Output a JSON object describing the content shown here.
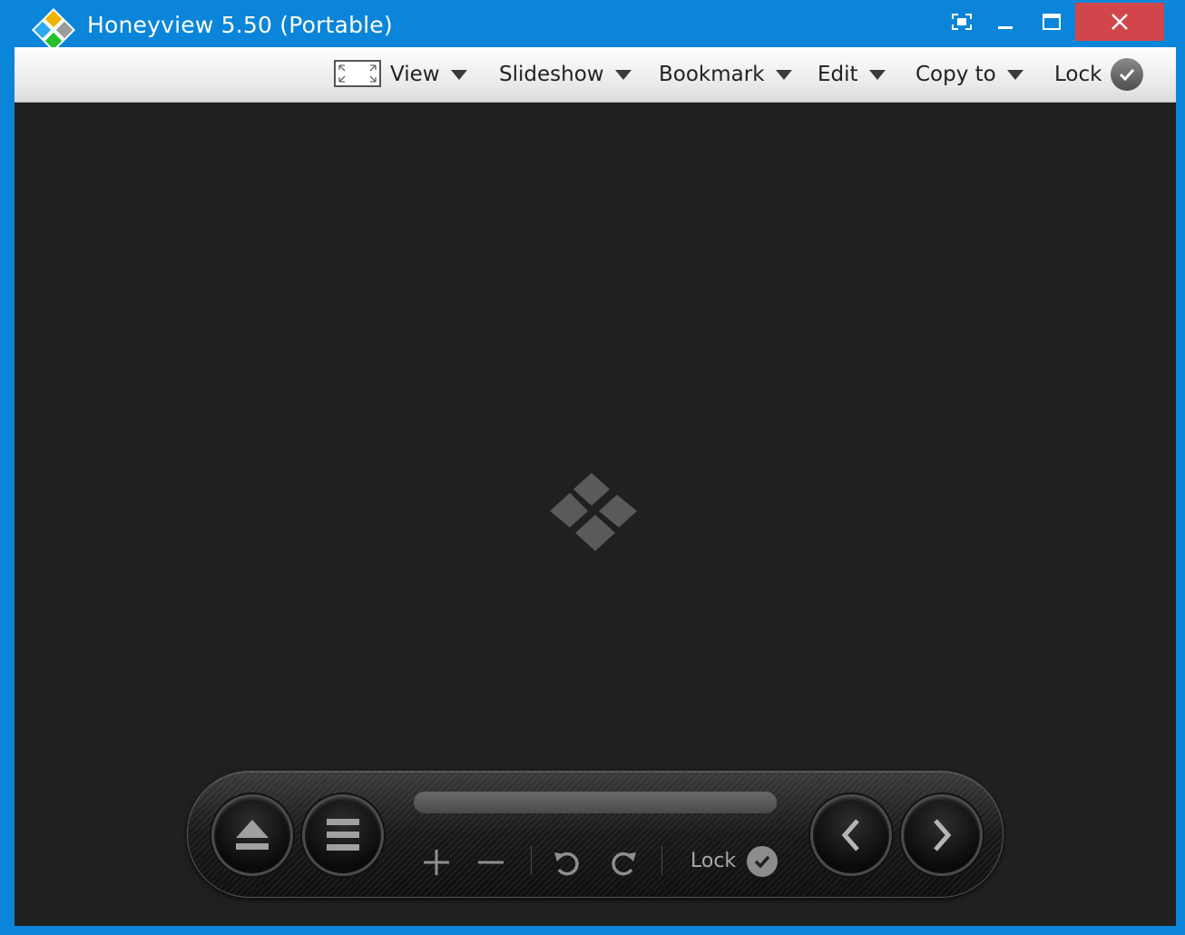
{
  "window": {
    "title": "Honeyview 5.50 (Portable)",
    "controls": [
      "fullscreen-icon",
      "minimize-icon",
      "maximize-icon",
      "close-icon"
    ],
    "accent_color": "#0a85d9",
    "close_color": "#d1464b"
  },
  "menu": {
    "items": [
      {
        "label": "View"
      },
      {
        "label": "Slideshow"
      },
      {
        "label": "Bookmark"
      },
      {
        "label": "Edit"
      },
      {
        "label": "Copy to"
      }
    ],
    "lock_label": "Lock"
  },
  "viewer": {
    "background": "#202020",
    "placeholder_icon": "honeyview-diamond-logo"
  },
  "controlbar": {
    "buttons": [
      "eject-icon",
      "menu-icon",
      "zoom-in-icon",
      "zoom-out-icon",
      "rotate-left-icon",
      "rotate-right-icon",
      "previous-icon",
      "next-icon"
    ],
    "lock_label": "Lock"
  }
}
